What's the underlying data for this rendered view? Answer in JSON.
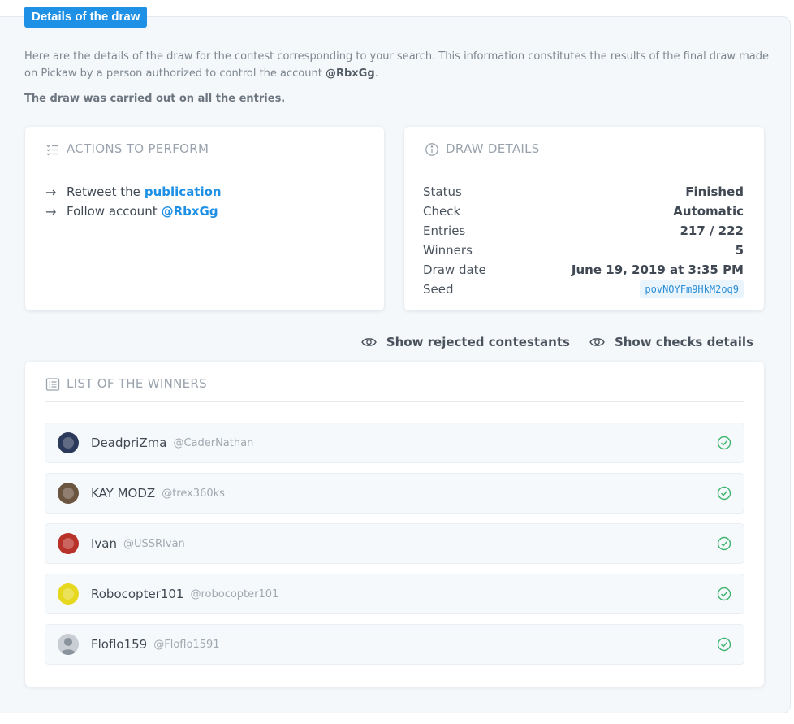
{
  "badge": "Details of the draw",
  "intro": {
    "text": "Here are the details of the draw for the contest corresponding to your search. This information constitutes the results of the final draw made on Pickaw by a person authorized to control the account ",
    "account": "@RbxGg",
    "end": ".",
    "strong": "The draw was carried out on all the entries."
  },
  "actions": {
    "title": "ACTIONS TO PERFORM",
    "items": [
      {
        "text": "Retweet the",
        "link": "publication"
      },
      {
        "text": "Follow account",
        "link": "@RbxGg"
      }
    ]
  },
  "details": {
    "title": "DRAW DETAILS",
    "rows": [
      {
        "label": "Status",
        "value": "Finished"
      },
      {
        "label": "Check",
        "value": "Automatic"
      },
      {
        "label": "Entries",
        "value": "217 / 222"
      },
      {
        "label": "Winners",
        "value": "5"
      },
      {
        "label": "Draw date",
        "value": "June 19, 2019 at 3:35 PM"
      },
      {
        "label": "Seed",
        "value": "povNOYFm9HkM2oq9"
      }
    ]
  },
  "toggles": {
    "rejected": "Show rejected contestants",
    "checks": "Show checks details"
  },
  "winners": {
    "title": "LIST OF THE WINNERS",
    "items": [
      {
        "name": "DeadpriZma",
        "handle": "@CaderNathan",
        "avatar_color": "#2b3a5a"
      },
      {
        "name": "KAY MODZ",
        "handle": "@trex360ks",
        "avatar_color": "#6b5440"
      },
      {
        "name": "Ivan",
        "handle": "@USSRIvan",
        "avatar_color": "#b8322a"
      },
      {
        "name": "Robocopter101",
        "handle": "@robocopter101",
        "avatar_color": "#e6d81f"
      },
      {
        "name": "Floflo159",
        "handle": "@Floflo1591",
        "avatar_color": "#c9ced4"
      }
    ]
  },
  "colors": {
    "accent": "#1e90e6",
    "check": "#3cb46e"
  }
}
